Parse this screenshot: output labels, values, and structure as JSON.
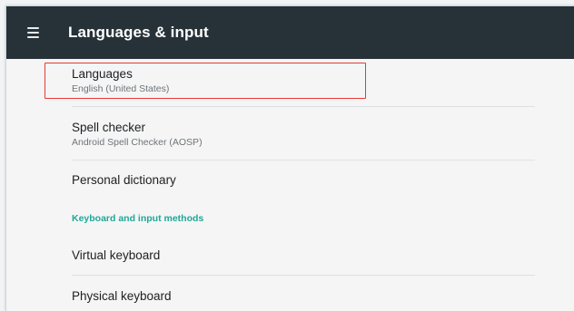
{
  "app_bar": {
    "title": "Languages & input",
    "menu_icon": "hamburger-menu-icon"
  },
  "preferences": {
    "languages": {
      "title": "Languages",
      "summary": "English (United States)"
    },
    "spell_checker": {
      "title": "Spell checker",
      "summary": "Android Spell Checker (AOSP)"
    },
    "personal_dictionary": {
      "title": "Personal dictionary"
    },
    "keyboard_category": {
      "label": "Keyboard and input methods"
    },
    "virtual_keyboard": {
      "title": "Virtual keyboard"
    },
    "physical_keyboard": {
      "title": "Physical keyboard"
    }
  },
  "colors": {
    "app_bar": "#263238",
    "accent": "#1ea89a",
    "highlight_box": "#e53935"
  }
}
